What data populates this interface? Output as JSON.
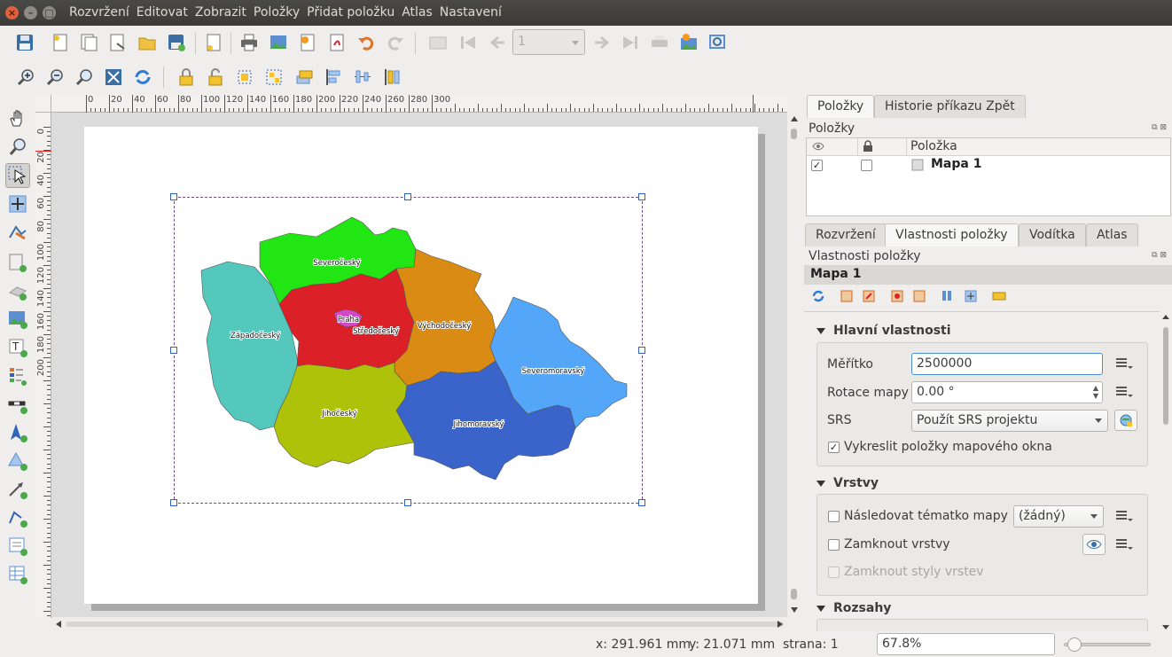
{
  "menubar": {
    "items": [
      "Rozvržení",
      "Editovat",
      "Zobrazit",
      "Položky",
      "Přidat položku",
      "Atlas",
      "Nastavení"
    ]
  },
  "toolbar": {
    "page_field_value": "1",
    "icons": [
      "save-icon",
      "new-layout-icon",
      "duplicate-layout-icon",
      "layout-manager-icon",
      "open-template-icon",
      "save-template-icon",
      "page-setup-icon",
      "print-icon",
      "export-image-icon",
      "export-svg-icon",
      "export-pdf-icon",
      "undo-icon",
      "redo-icon",
      "atlas-preview-icon",
      "first-feature-icon",
      "prev-feature-icon",
      "next-feature-icon",
      "last-feature-icon",
      "atlas-print-icon",
      "atlas-export-icon",
      "atlas-settings-icon"
    ]
  },
  "ruler": {
    "top_ticks": [
      "0",
      "20",
      "40",
      "60",
      "80",
      "100",
      "120",
      "140",
      "160",
      "180",
      "200",
      "220",
      "240",
      "260",
      "280",
      "300"
    ],
    "left_ticks": [
      "0",
      "20",
      "40",
      "60",
      "80",
      "100",
      "120",
      "140",
      "160",
      "180",
      "200"
    ]
  },
  "map": {
    "regions": [
      {
        "name": "Severočeský",
        "color": "#22e614"
      },
      {
        "name": "Západočeský",
        "color": "#55c8be"
      },
      {
        "name": "Praha",
        "color": "#d447c8"
      },
      {
        "name": "Středočeský",
        "color": "#dc2027"
      },
      {
        "name": "Východočeský",
        "color": "#da8b13"
      },
      {
        "name": "Severomoravský",
        "color": "#53a6f8"
      },
      {
        "name": "Jihočeský",
        "color": "#aec20a"
      },
      {
        "name": "Jihomoravský",
        "color": "#3a64c9"
      }
    ]
  },
  "items_panel": {
    "tabs": [
      "Položky",
      "Historie příkazu Zpět"
    ],
    "title": "Položky",
    "column_header": "Položka",
    "rows": [
      {
        "visible": true,
        "locked": false,
        "name": "Mapa 1"
      }
    ]
  },
  "props_panel": {
    "tabs": [
      "Rozvržení",
      "Vlastnosti položky",
      "Vodítka",
      "Atlas"
    ],
    "title": "Vlastnosti položky",
    "item_name": "Mapa 1",
    "main_section": {
      "header": "Hlavní vlastnosti",
      "scale_label": "Měřítko",
      "scale_value": "2500000",
      "rotation_label": "Rotace mapy",
      "rotation_value": "0.00 °",
      "srs_label": "SRS",
      "srs_value": "Použít SRS projektu",
      "draw_items_label": "Vykreslit položky mapového okna",
      "draw_items_checked": true
    },
    "layers_section": {
      "header": "Vrstvy",
      "follow_theme_label": "Následovat tématko mapy",
      "theme_value": "(žádný)",
      "lock_layers_label": "Zamknout vrstvy",
      "lock_styles_label": "Zamknout styly vrstev"
    },
    "extents_section": {
      "header": "Rozsahy"
    }
  },
  "statusbar": {
    "x_coord": "x: 291.961 mm",
    "y_coord": "y: 21.071 mm",
    "page": "strana: 1",
    "zoom": "67.8%",
    "zoom_slider_fraction": 0.04
  }
}
